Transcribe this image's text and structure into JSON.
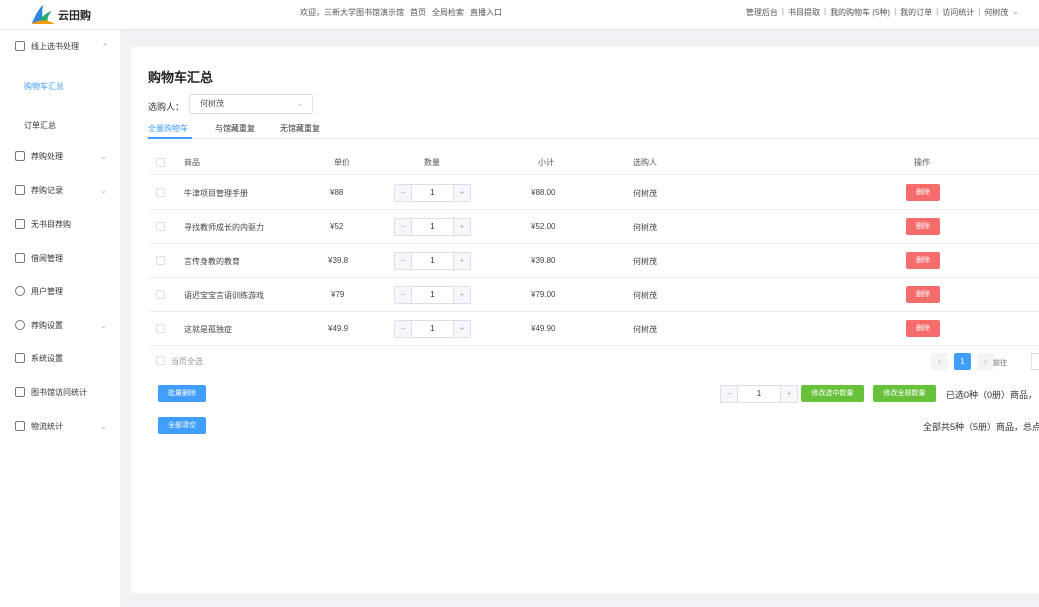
{
  "header": {
    "logo_text": "云田购",
    "welcome": "欢迎，三新大学图书馆演示馆",
    "nav": [
      "首页",
      "全局检索",
      "直播入口"
    ],
    "right_links": [
      "管理后台",
      "|",
      "书目提取",
      "|",
      "我的购物车 (5种)",
      "|",
      "我的订单",
      "|",
      "访问统计",
      "|",
      "何树茂"
    ]
  },
  "sidebar": {
    "items": [
      {
        "label": "线上选书处理",
        "chevron": "^"
      },
      {
        "label": "购物车汇总"
      },
      {
        "label": "订单汇总"
      },
      {
        "label": "荐购处理",
        "chevron": "⌄"
      },
      {
        "label": "荐购记录",
        "chevron": "⌄"
      },
      {
        "label": "无书目荐购"
      },
      {
        "label": "借阅管理"
      },
      {
        "label": "用户管理"
      },
      {
        "label": "荐购设置",
        "chevron": "⌄"
      },
      {
        "label": "系统设置"
      },
      {
        "label": "图书馆访问统计"
      },
      {
        "label": "物流统计",
        "chevron": "⌄"
      }
    ]
  },
  "main": {
    "title": "购物车汇总",
    "buyer_label": "选购人：",
    "buyer_value": "何树茂",
    "tabs": [
      "全量购物车",
      "与馆藏重复",
      "无馆藏重复"
    ],
    "columns": [
      "商品",
      "单价",
      "数量",
      "小计",
      "选购人",
      "操作"
    ],
    "rows": [
      {
        "name": "牛津项目管理手册",
        "price": "¥88",
        "qty": "1",
        "subtotal": "¥88.00",
        "buyer": "何树茂",
        "action": "删除"
      },
      {
        "name": "寻找教师成长的内驱力",
        "price": "¥52",
        "qty": "1",
        "subtotal": "¥52.00",
        "buyer": "何树茂",
        "action": "删除"
      },
      {
        "name": "言传身教的教育",
        "price": "¥39.8",
        "qty": "1",
        "subtotal": "¥39.80",
        "buyer": "何树茂",
        "action": "删除"
      },
      {
        "name": "语迟宝宝言语训练游戏",
        "price": "¥79",
        "qty": "1",
        "subtotal": "¥79.00",
        "buyer": "何树茂",
        "action": "删除"
      },
      {
        "name": "这就是孤独症",
        "price": "¥49.9",
        "qty": "1",
        "subtotal": "¥49.90",
        "buyer": "何树茂",
        "action": "删除"
      }
    ],
    "select_all": "当页全选",
    "pager": {
      "prev": "‹",
      "current": "1",
      "next": "›",
      "goto": "前往"
    },
    "batch_delete": "批量删除",
    "clear_all": "全部清空",
    "bulk_qty": "1",
    "modify_selected": "修改选中数量",
    "modify_all": "修改全部数量",
    "selected_summary": "已选0种（0册）商品，",
    "total_summary": "全部共5种（5册）商品，总点"
  },
  "colors": {
    "accent": "#409eff",
    "danger": "#f56c6c",
    "success": "#67c23a"
  }
}
